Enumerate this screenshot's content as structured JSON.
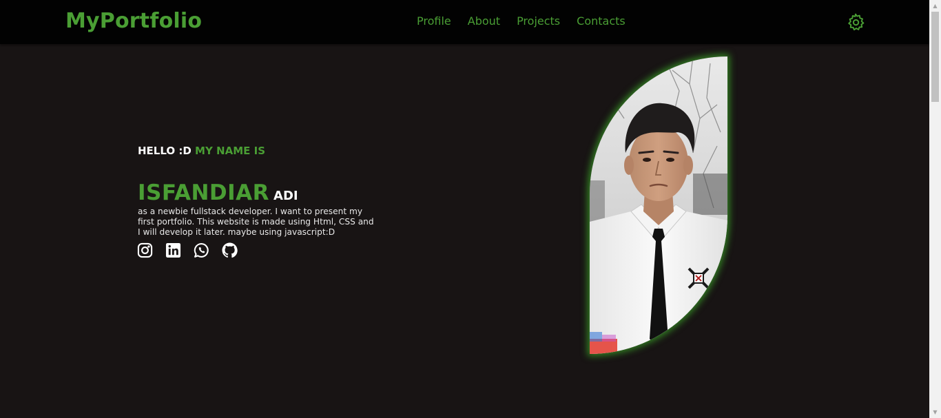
{
  "navbar": {
    "brand": "MyPortfolio",
    "links": [
      "Profile",
      "About",
      "Projects",
      "Contacts"
    ],
    "settings_icon": "gear-icon"
  },
  "hero": {
    "greeting_prefix": "HELLO :D",
    "greeting_suffix": "MY NAME IS",
    "first_name": "ISFANDIAR",
    "last_name": "ADI",
    "description": "as a newbie fullstack developer. I want to present my first portfolio. This website is made using Html, CSS and I will develop it later. maybe using javascript:D",
    "socials": [
      "instagram-icon",
      "linkedin-icon",
      "whatsapp-icon",
      "github-icon"
    ],
    "photo_alt": "profile photo"
  },
  "colors": {
    "accent": "#4a9e34",
    "navbar_bg": "#020202",
    "page_bg": "#181414",
    "text": "#ffffff"
  }
}
